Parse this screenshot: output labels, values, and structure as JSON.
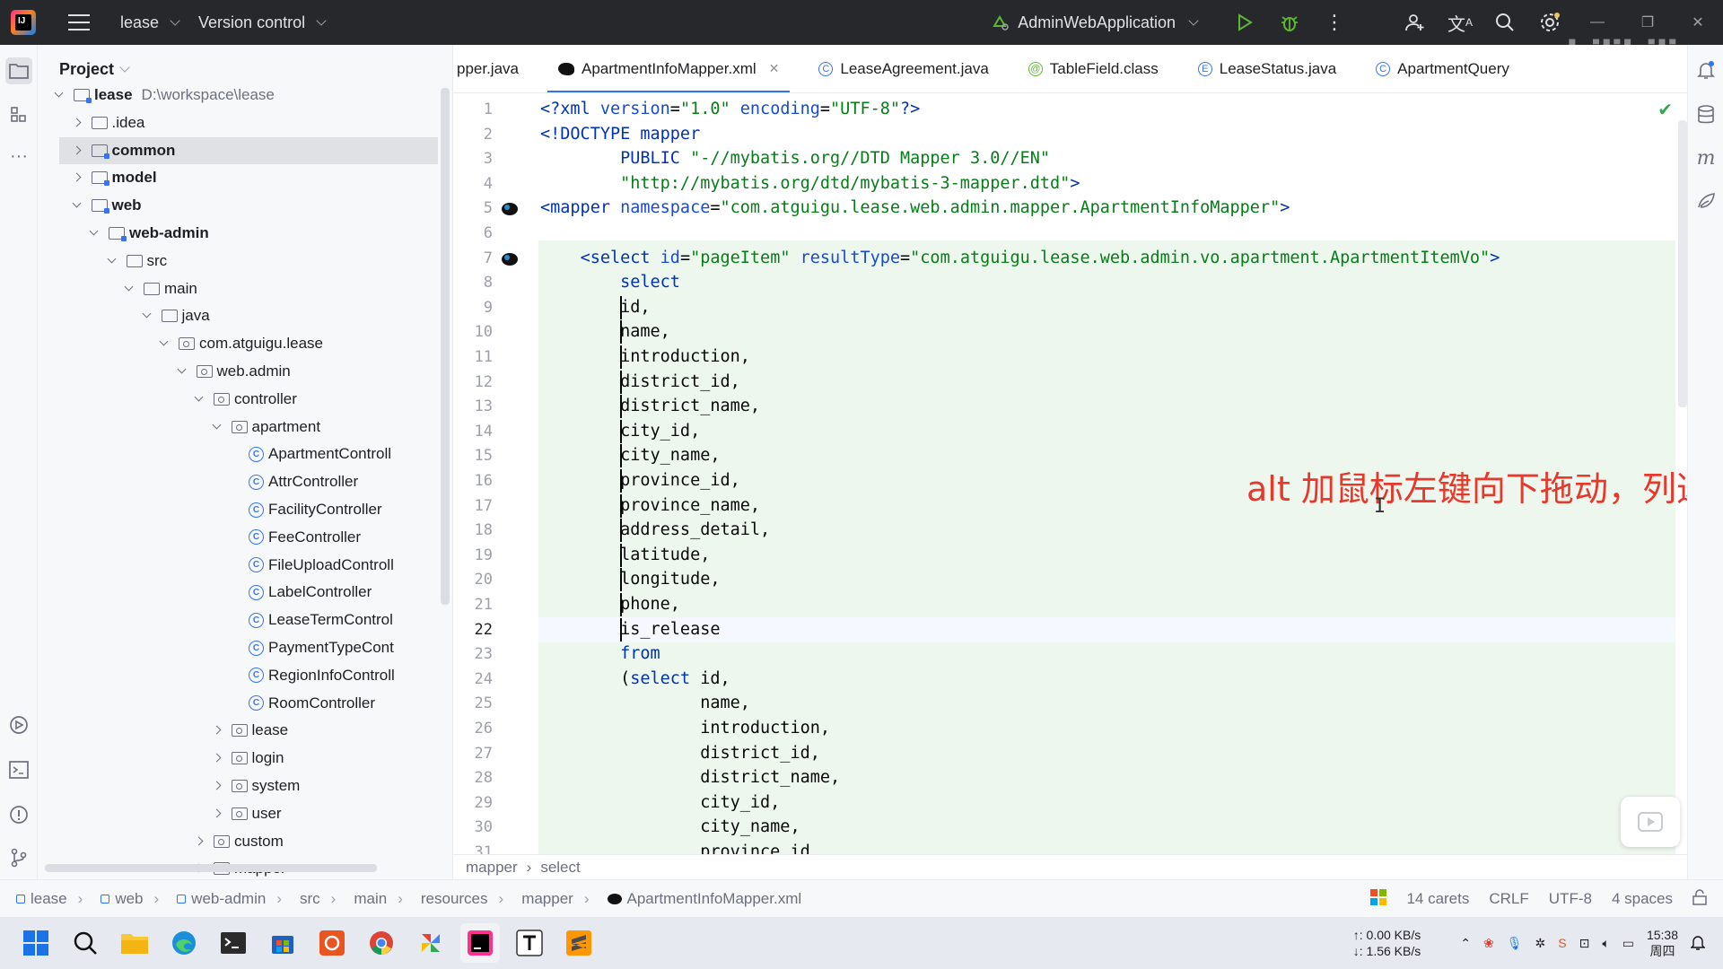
{
  "titlebar": {
    "project": "lease",
    "vcs": "Version control",
    "run_config": "AdminWebApplication"
  },
  "project_panel": {
    "title": "Project",
    "root_path": "D:\\workspace\\lease",
    "tree": [
      {
        "label": "lease",
        "kind": "module",
        "depth": 0,
        "expanded": true
      },
      {
        "label": ".idea",
        "kind": "folder",
        "depth": 1,
        "expanded": false
      },
      {
        "label": "common",
        "kind": "module",
        "depth": 1,
        "expanded": false,
        "selected": true
      },
      {
        "label": "model",
        "kind": "module",
        "depth": 1,
        "expanded": false
      },
      {
        "label": "web",
        "kind": "module",
        "depth": 1,
        "expanded": true
      },
      {
        "label": "web-admin",
        "kind": "module",
        "depth": 2,
        "expanded": true
      },
      {
        "label": "src",
        "kind": "folder",
        "depth": 3,
        "expanded": true
      },
      {
        "label": "main",
        "kind": "folder",
        "depth": 4,
        "expanded": true
      },
      {
        "label": "java",
        "kind": "folder",
        "depth": 5,
        "expanded": true
      },
      {
        "label": "com.atguigu.lease",
        "kind": "package",
        "depth": 6,
        "expanded": true
      },
      {
        "label": "web.admin",
        "kind": "package",
        "depth": 7,
        "expanded": true
      },
      {
        "label": "controller",
        "kind": "package",
        "depth": 8,
        "expanded": true
      },
      {
        "label": "apartment",
        "kind": "package",
        "depth": 9,
        "expanded": true
      },
      {
        "label": "ApartmentControll",
        "kind": "class",
        "depth": 10
      },
      {
        "label": "AttrController",
        "kind": "class",
        "depth": 10
      },
      {
        "label": "FacilityController",
        "kind": "class",
        "depth": 10
      },
      {
        "label": "FeeController",
        "kind": "class",
        "depth": 10
      },
      {
        "label": "FileUploadControll",
        "kind": "class",
        "depth": 10
      },
      {
        "label": "LabelController",
        "kind": "class",
        "depth": 10
      },
      {
        "label": "LeaseTermControl",
        "kind": "class",
        "depth": 10
      },
      {
        "label": "PaymentTypeCont",
        "kind": "class",
        "depth": 10
      },
      {
        "label": "RegionInfoControll",
        "kind": "class",
        "depth": 10
      },
      {
        "label": "RoomController",
        "kind": "class",
        "depth": 10
      },
      {
        "label": "lease",
        "kind": "package",
        "depth": 9,
        "expanded": false
      },
      {
        "label": "login",
        "kind": "package",
        "depth": 9,
        "expanded": false
      },
      {
        "label": "system",
        "kind": "package",
        "depth": 9,
        "expanded": false
      },
      {
        "label": "user",
        "kind": "package",
        "depth": 9,
        "expanded": false
      },
      {
        "label": "custom",
        "kind": "package",
        "depth": 8,
        "expanded": false
      },
      {
        "label": "mapper",
        "kind": "package",
        "depth": 8,
        "expanded": false
      }
    ]
  },
  "tabs": [
    {
      "label": "pper.java",
      "icon": "class-icon"
    },
    {
      "label": "ApartmentInfoMapper.xml",
      "icon": "mybatis-icon",
      "active": true
    },
    {
      "label": "LeaseAgreement.java",
      "icon": "class-icon"
    },
    {
      "label": "TableField.class",
      "icon": "annotation-icon"
    },
    {
      "label": "LeaseStatus.java",
      "icon": "enum-icon"
    },
    {
      "label": "ApartmentQuery",
      "icon": "class-icon"
    }
  ],
  "editor": {
    "current_line": 22,
    "lines": [
      {
        "n": "1",
        "html": "<span class=\"kw\">&lt;?xml </span><span class=\"attr\">version</span>=<span class=\"str\">\"1.0\"</span> <span class=\"attr\">encoding</span>=<span class=\"str\">\"UTF-8\"</span><span class=\"kw\">?&gt;</span>"
      },
      {
        "n": "2",
        "html": "<span class=\"tag\">&lt;!DOCTYPE mapper</span>"
      },
      {
        "n": "3",
        "html": "        <span class=\"tag\">PUBLIC</span> <span class=\"str\">\"-//mybatis.org//DTD Mapper 3.0//EN\"</span>"
      },
      {
        "n": "4",
        "html": "        <span class=\"str\">\"http://mybatis.org/dtd/mybatis-3-mapper.dtd\"</span><span class=\"tag\">&gt;</span>"
      },
      {
        "n": "5",
        "html": "<span class=\"tag\">&lt;mapper </span><span class=\"attr\">namespace</span>=<span class=\"str\">\"com.atguigu.lease.web.admin.mapper.ApartmentInfoMapper\"</span><span class=\"tag\">&gt;</span>"
      },
      {
        "n": "6",
        "html": ""
      },
      {
        "n": "7",
        "html": "    <span class=\"tag\">&lt;select </span><span class=\"attr\">id</span>=<span class=\"str\">\"pageItem\"</span> <span class=\"attr\">resultType</span>=<span class=\"str\">\"com.atguigu.lease.web.admin.vo.apartment.ApartmentItemVo\"</span><span class=\"tag\">&gt;</span>"
      },
      {
        "n": "8",
        "html": "        <span class=\"kw\">select</span>"
      },
      {
        "n": "9",
        "html": "        id,"
      },
      {
        "n": "10",
        "html": "        name,"
      },
      {
        "n": "11",
        "html": "        introduction,"
      },
      {
        "n": "12",
        "html": "        district_id,"
      },
      {
        "n": "13",
        "html": "        district_name,"
      },
      {
        "n": "14",
        "html": "        city_id,"
      },
      {
        "n": "15",
        "html": "        city_name,"
      },
      {
        "n": "16",
        "html": "        province_id,"
      },
      {
        "n": "17",
        "html": "        province_name,"
      },
      {
        "n": "18",
        "html": "        address_detail,"
      },
      {
        "n": "19",
        "html": "        latitude,"
      },
      {
        "n": "20",
        "html": "        longitude,"
      },
      {
        "n": "21",
        "html": "        phone,"
      },
      {
        "n": "22",
        "html": "        is_release"
      },
      {
        "n": "23",
        "html": "        <span class=\"kw\">from</span>"
      },
      {
        "n": "24",
        "html": "        (<span class=\"kw\">select</span> id,"
      },
      {
        "n": "25",
        "html": "                name,"
      },
      {
        "n": "26",
        "html": "                introduction,"
      },
      {
        "n": "27",
        "html": "                district_id,"
      },
      {
        "n": "28",
        "html": "                district_name,"
      },
      {
        "n": "29",
        "html": "                city_id,"
      },
      {
        "n": "30",
        "html": "                city_name,"
      },
      {
        "n": "31",
        "html": "                province_id,"
      }
    ],
    "overlay_text": "alt 加鼠标左键向下拖动，列选模式。"
  },
  "editor_breadcrumb": [
    "mapper",
    "select"
  ],
  "statusbar": {
    "path": [
      "lease",
      "web",
      "web-admin",
      "src",
      "main",
      "resources",
      "mapper",
      "ApartmentInfoMapper.xml"
    ],
    "carets": "14 carets",
    "line_sep": "CRLF",
    "encoding": "UTF-8",
    "indent": "4 spaces"
  },
  "taskbar": {
    "net_up": "↑: 0.00 KB/s",
    "net_down": "↓: 1.56 KB/s",
    "time": "15:38",
    "day": "周四"
  },
  "colors": {
    "accent": "#3574f0",
    "overlay": "#e8372b",
    "selection_bg": "#eef7ee"
  }
}
